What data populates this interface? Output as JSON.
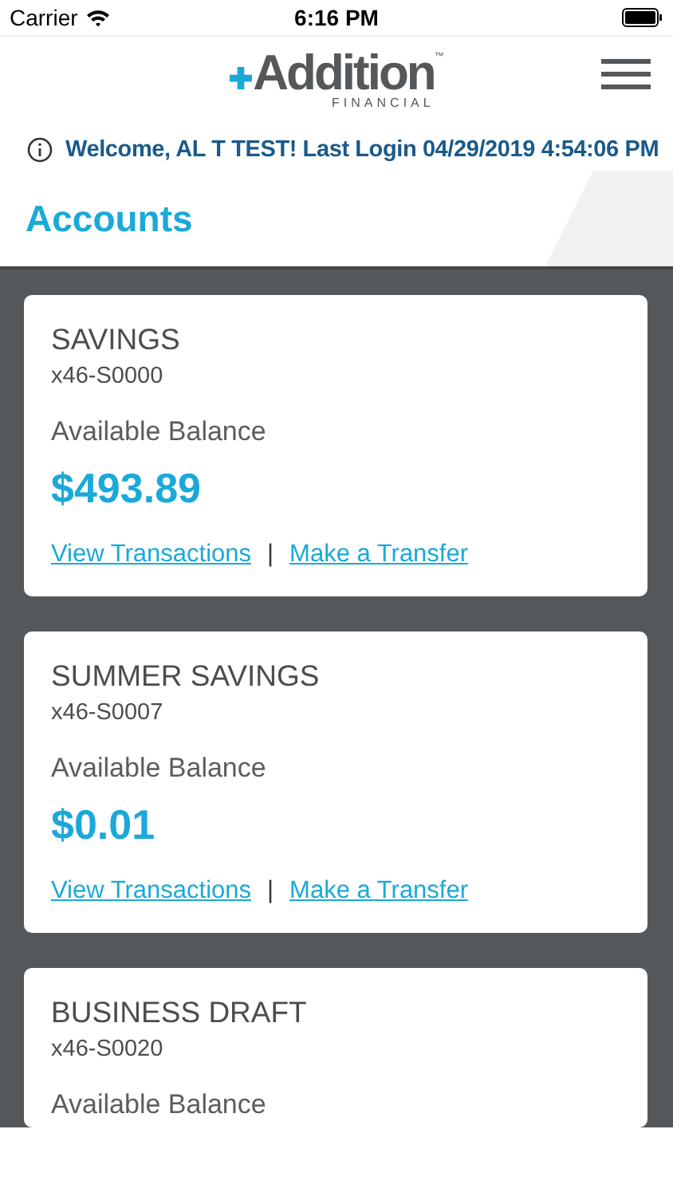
{
  "status_bar": {
    "carrier": "Carrier",
    "time": "6:16 PM"
  },
  "header": {
    "logo": "Addition",
    "logo_mark": "™",
    "logo_subtitle": "FINANCIAL"
  },
  "welcome": "Welcome, AL T TEST! Last Login 04/29/2019 4:54:06 PM",
  "title": "Accounts",
  "accounts": [
    {
      "name": "SAVINGS",
      "number": "x46-S0000",
      "balance_label": "Available Balance",
      "balance": "$493.89",
      "links": [
        "View Transactions",
        "Make a Transfer"
      ],
      "separator": "|"
    },
    {
      "name": "SUMMER SAVINGS",
      "number": "x46-S0007",
      "balance_label": "Available Balance",
      "balance": "$0.01",
      "links": [
        "View Transactions",
        "Make a Transfer"
      ],
      "separator": "|"
    },
    {
      "name": "BUSINESS DRAFT",
      "number": "x46-S0020",
      "balance_label": "Available Balance"
    }
  ]
}
